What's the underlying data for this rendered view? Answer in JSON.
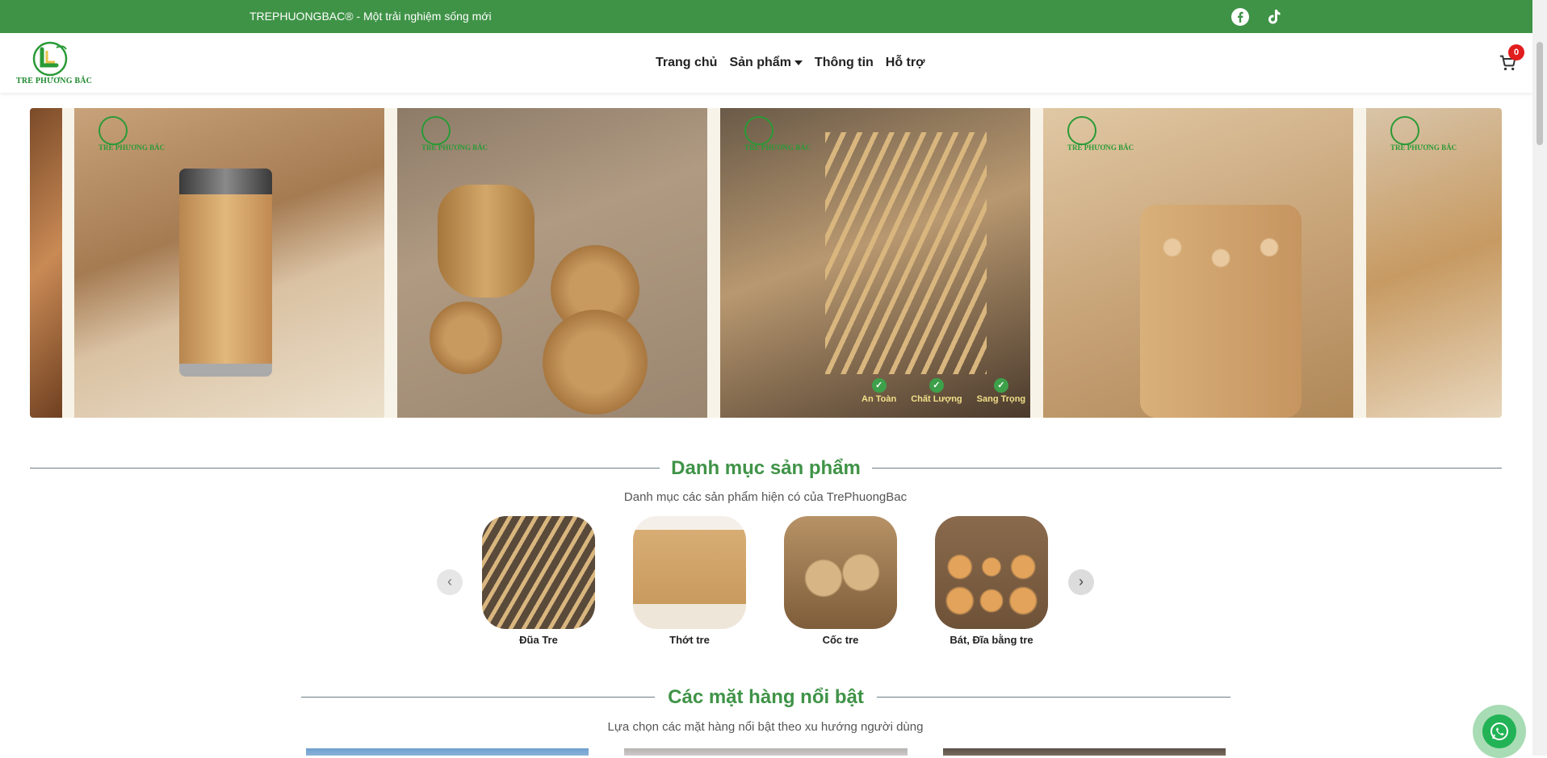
{
  "topbar": {
    "tagline": "TREPHUONGBAC® - Một trải nghiệm sống mới",
    "icons": [
      "facebook-icon",
      "tiktok-icon"
    ],
    "color": "#3f9347"
  },
  "header": {
    "logo_text": "TRE PHƯƠNG BẮC",
    "nav": [
      "Trang chủ",
      "Sản phẩm",
      "Thông tin",
      "Hỗ trợ"
    ],
    "cart_count": "0"
  },
  "carousel": {
    "watermark": "TRE PHƯƠNG BẮC",
    "badges": [
      "An Toàn",
      "Chất Lượng",
      "Sang Trọng"
    ]
  },
  "categories": {
    "title": "Danh mục sản phẩm",
    "subtitle": "Danh mục các sản phẩm hiện có của TrePhuongBac",
    "items": [
      "Đũa Tre",
      "Thớt tre",
      "Cốc tre",
      "Bát, Đĩa bằng tre"
    ],
    "prev": "‹",
    "next": "›"
  },
  "featured": {
    "title": "Các mặt hàng nổi bật",
    "subtitle": "Lựa chọn các mặt hàng nổi bật theo xu hướng người dùng"
  },
  "colors": {
    "accent": "#3f9347",
    "badge": "#e11d1d",
    "whatsapp": "#22b356"
  }
}
